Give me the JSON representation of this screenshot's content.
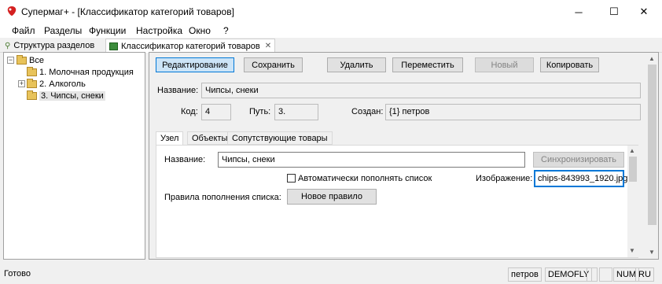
{
  "window": {
    "title": "Супермаг+  - [Классификатор категорий товаров]",
    "app_icon": "app-logo-icon"
  },
  "window_controls": {
    "minimize": "─",
    "maximize": "☐",
    "close": "✕"
  },
  "menu": [
    "Файл",
    "Разделы",
    "Функции",
    "Настройка",
    "Окно",
    "?"
  ],
  "doc_tabs": [
    {
      "label": "Структура разделов",
      "icon": "pin-icon"
    },
    {
      "label": "Классификатор категорий товаров",
      "icon": "classifier-icon",
      "close": "✕"
    }
  ],
  "tree": {
    "root": "Все",
    "items": [
      "1. Молочная продукция",
      "2. Алкоголь",
      "3. Чипсы, снеки"
    ],
    "expand_glyph": "+"
  },
  "toolbar": {
    "edit": "Редактирование",
    "save": "Сохранить",
    "delete": "Удалить",
    "move": "Переместить",
    "new": "Новый",
    "copy": "Копировать"
  },
  "details": {
    "name_label": "Название:",
    "name_value": "Чипсы, снеки",
    "code_label": "Код:",
    "code_value": "4",
    "path_label": "Путь:",
    "path_value": "3.",
    "created_label": "Создан:",
    "created_value": "{1} петров"
  },
  "inner_tabs": [
    "Узел",
    "Объекты",
    "Сопутствующие товары"
  ],
  "node": {
    "name_label": "Название:",
    "name_value": "Чипсы, снеки",
    "sync_button": "Синхронизировать",
    "auto_fill_label": "Автоматически пополнять список",
    "image_label": "Изображение:",
    "image_value": "chips-843993_1920.jpg",
    "rules_label": "Правила пополнения списка:",
    "new_rule_button": "Новое правило"
  },
  "status": {
    "text": "Готово",
    "user": "петров",
    "host": "DEMOFLY",
    "num": "NUM",
    "lang": "RU"
  },
  "colors": {
    "accent": "#0078d7",
    "button_active_bg": "#cce4f7",
    "folder": "#e8c35a"
  }
}
